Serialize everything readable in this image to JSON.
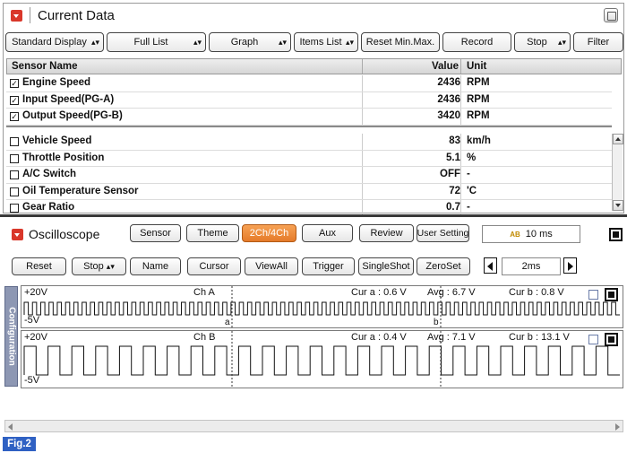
{
  "current_data": {
    "title": "Current Data",
    "toolbar": [
      {
        "label": "Standard Display",
        "dropdown": true
      },
      {
        "label": "Full List",
        "dropdown": true
      },
      {
        "label": "Graph",
        "dropdown": true
      },
      {
        "label": "Items List",
        "dropdown": true
      },
      {
        "label": "Reset Min.Max.",
        "dropdown": false
      },
      {
        "label": "Record",
        "dropdown": false
      },
      {
        "label": "Stop",
        "dropdown": true
      },
      {
        "label": "Filter",
        "dropdown": false
      }
    ],
    "columns": {
      "name": "Sensor Name",
      "value": "Value",
      "unit": "Unit"
    },
    "fixed_rows": [
      {
        "checked": true,
        "name": "Engine Speed",
        "value": "2436",
        "unit": "RPM"
      },
      {
        "checked": true,
        "name": "Input Speed(PG-A)",
        "value": "2436",
        "unit": "RPM"
      },
      {
        "checked": true,
        "name": "Output Speed(PG-B)",
        "value": "3420",
        "unit": "RPM"
      }
    ],
    "scroll_rows": [
      {
        "checked": false,
        "name": "Vehicle Speed",
        "value": "83",
        "unit": "km/h"
      },
      {
        "checked": false,
        "name": "Throttle Position",
        "value": "5.1",
        "unit": "%"
      },
      {
        "checked": false,
        "name": "A/C Switch",
        "value": "OFF",
        "unit": "-"
      },
      {
        "checked": false,
        "name": "Oil Temperature Sensor",
        "value": "72",
        "unit": "'C"
      },
      {
        "checked": false,
        "name": "Gear Ratio",
        "value": "0.7",
        "unit": "-"
      }
    ]
  },
  "oscilloscope": {
    "title": "Oscilloscope",
    "top_buttons": {
      "sensor": "Sensor",
      "theme": "Theme",
      "ch_mode": "2Ch/4Ch",
      "aux": "Aux",
      "review": "Review",
      "user_setting": "User Setting"
    },
    "trigger_time": "10 ms",
    "trigger_icon_text": "AB",
    "controls": {
      "reset": "Reset",
      "stop": "Stop",
      "name": "Name",
      "cursor": "Cursor",
      "view_all": "ViewAll",
      "trigger": "Trigger",
      "single_shot": "SingleShot",
      "zero_set": "ZeroSet"
    },
    "timebase": "2ms",
    "side_tab": "Configuration",
    "channels": [
      {
        "name": "Ch A",
        "v_max": "+20V",
        "v_min": "-5V",
        "cur_a": "Cur a : 0.6 V",
        "avg": "Avg : 6.7 V",
        "cur_b": "Cur b : 0.8 V",
        "cursor_a_label": "a",
        "cursor_b_label": "b"
      },
      {
        "name": "Ch B",
        "v_max": "+20V",
        "v_min": "-5V",
        "cur_a": "Cur a : 0.4 V",
        "avg": "Avg : 7.1 V",
        "cur_b": "Cur b : 13.1 V"
      }
    ],
    "waveforms": {
      "ch_a_pulses": 72,
      "ch_b_pulses": 25,
      "color": "#111111"
    }
  },
  "figure_label": "Fig.2",
  "colors": {
    "accent_orange": "#e57b2a",
    "collapse_red": "#d9372a",
    "fig_blue": "#2f61c3",
    "config_tab": "#8d97b3"
  }
}
